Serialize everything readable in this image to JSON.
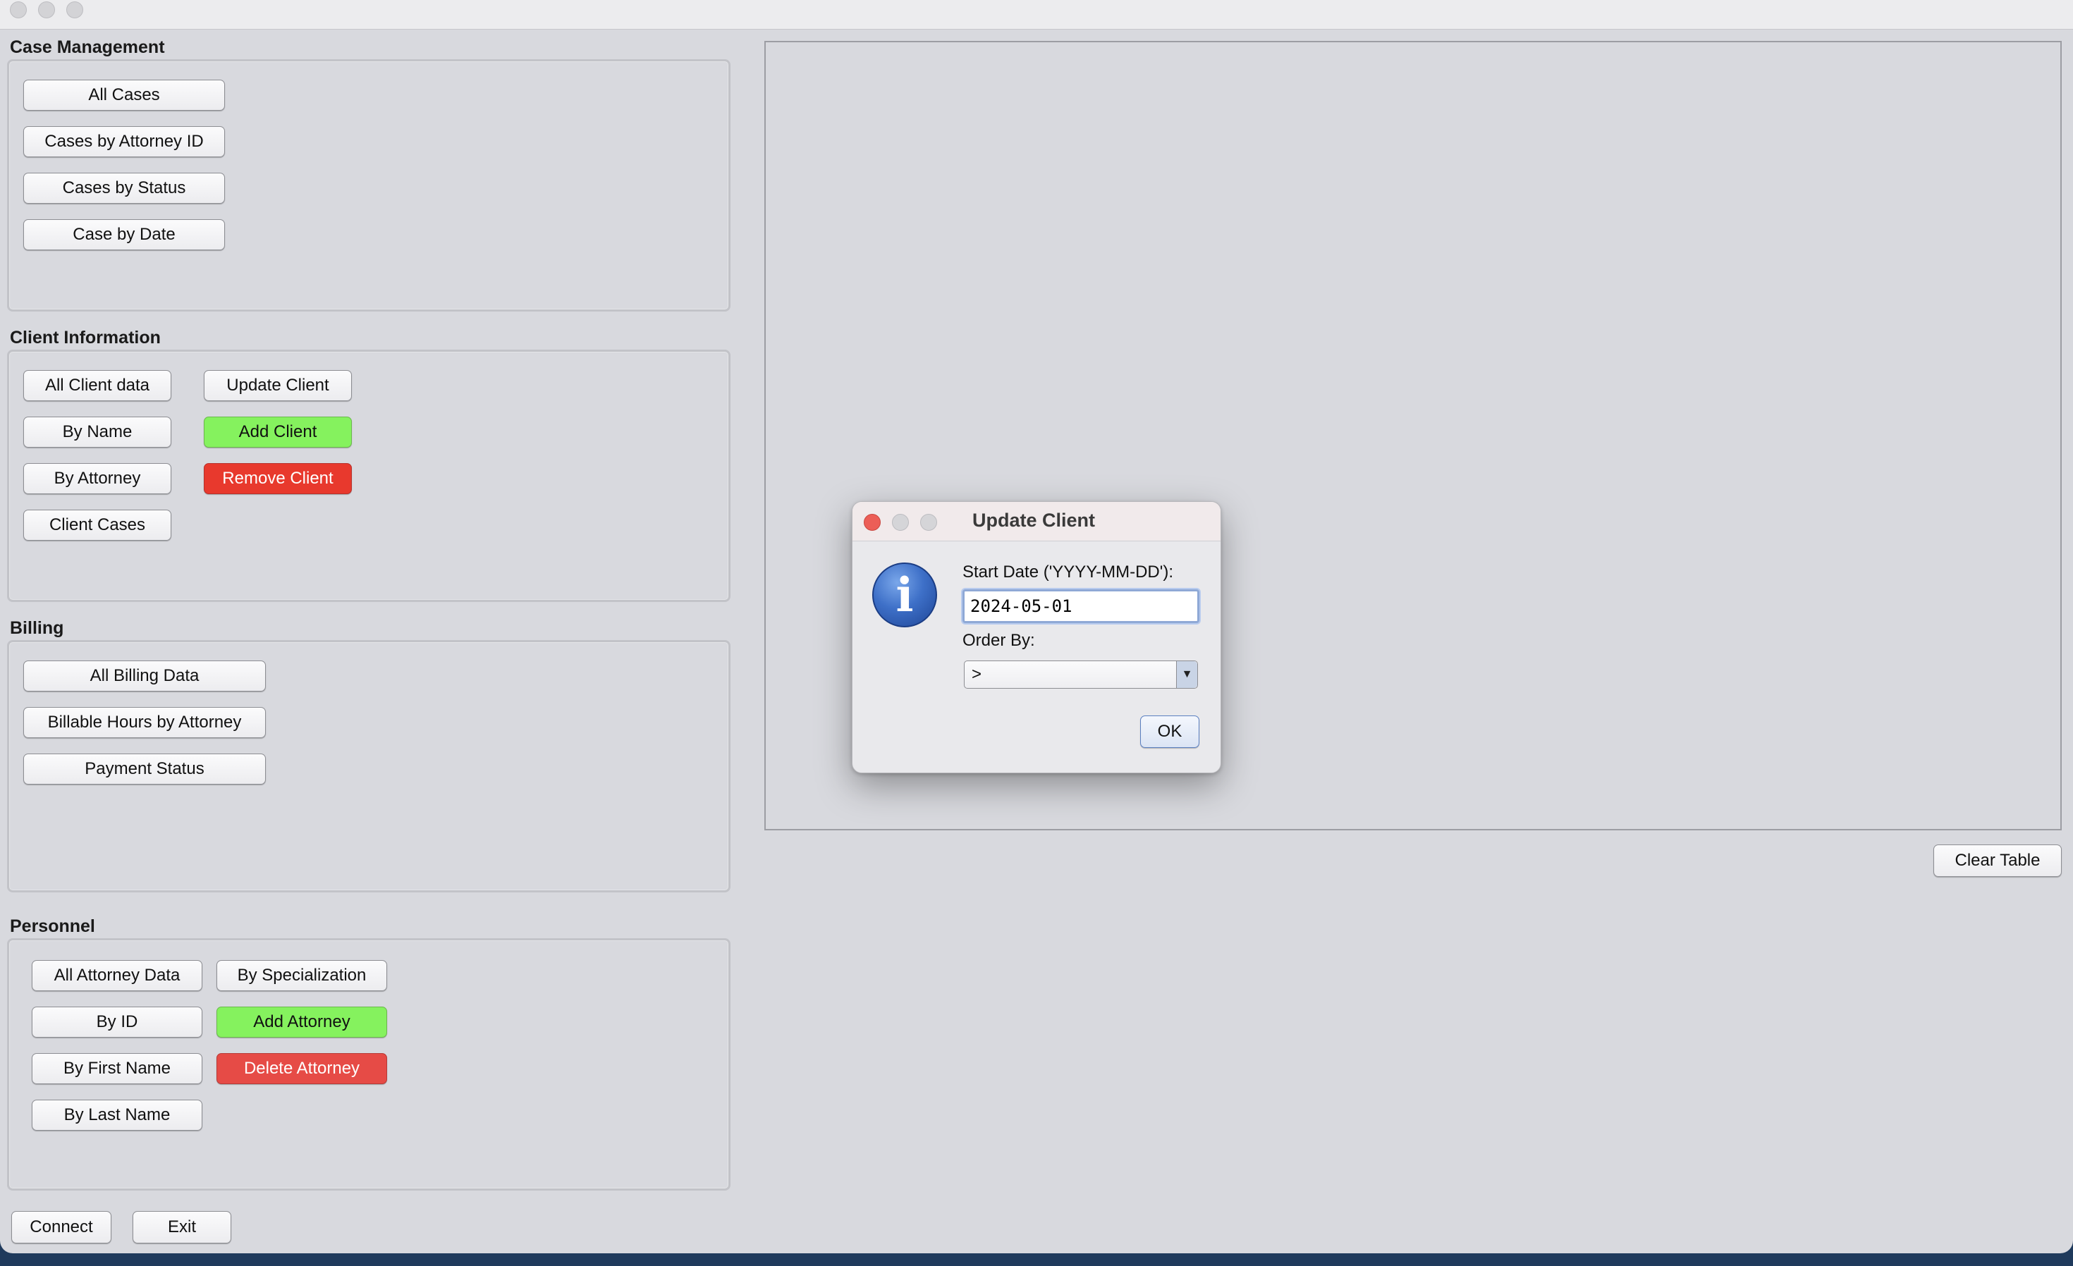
{
  "window": {
    "sections": {
      "case_management": {
        "title": "Case Management",
        "buttons": [
          "All Cases",
          "Cases by Attorney ID",
          "Cases by Status",
          "Case by Date"
        ]
      },
      "client_information": {
        "title": "Client Information",
        "left_buttons": [
          "All Client data",
          "By Name",
          "By Attorney",
          "Client Cases"
        ],
        "right_buttons": [
          "Update Client",
          "Add Client",
          "Remove Client"
        ]
      },
      "billing": {
        "title": "Billing",
        "buttons": [
          "All Billing Data",
          "Billable Hours by Attorney",
          "Payment Status"
        ]
      },
      "personnel": {
        "title": "Personnel",
        "left_buttons": [
          "All Attorney Data",
          "By ID",
          "By First Name",
          "By Last Name"
        ],
        "right_buttons": [
          "By Specialization",
          "Add Attorney",
          "Delete Attorney"
        ]
      }
    },
    "bottom_buttons": {
      "connect": "Connect",
      "exit": "Exit"
    },
    "clear_table": "Clear Table",
    "colors": {
      "add": "#85f25e",
      "remove": "#e8392d",
      "delete": "#e64b46"
    }
  },
  "dialog": {
    "title": "Update Client",
    "icon": "info-icon",
    "start_date_label": "Start Date ('YYYY-MM-DD'):",
    "start_date_value": "2024-05-01",
    "order_by_label": "Order By:",
    "order_by_value": ">",
    "ok": "OK"
  }
}
